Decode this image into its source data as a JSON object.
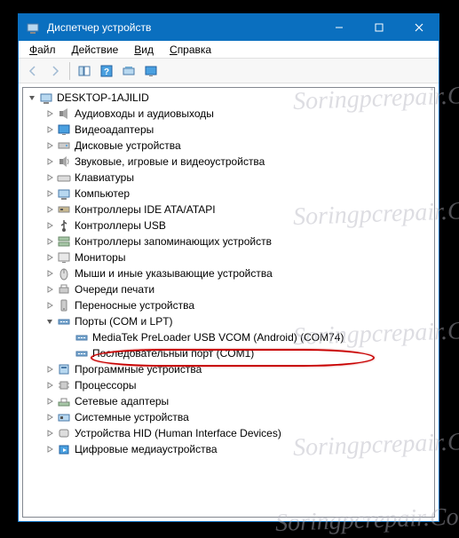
{
  "window": {
    "title": "Диспетчер устройств"
  },
  "menubar": {
    "file": "Файл",
    "action": "Действие",
    "view": "Вид",
    "help": "Справка"
  },
  "toolbar": {
    "back": "back",
    "forward": "forward",
    "showhide": "show-hide-console-tree",
    "help": "help",
    "scan": "scan-hardware",
    "monitor": "monitor"
  },
  "tree": {
    "root": "DESKTOP-1AJILID",
    "items": [
      {
        "label": "Аудиовходы и аудиовыходы",
        "icon": "audio"
      },
      {
        "label": "Видеоадаптеры",
        "icon": "display"
      },
      {
        "label": "Дисковые устройства",
        "icon": "disk"
      },
      {
        "label": "Звуковые, игровые и видеоустройства",
        "icon": "sound"
      },
      {
        "label": "Клавиатуры",
        "icon": "keyboard"
      },
      {
        "label": "Компьютер",
        "icon": "computer"
      },
      {
        "label": "Контроллеры IDE ATA/ATAPI",
        "icon": "ide"
      },
      {
        "label": "Контроллеры USB",
        "icon": "usb"
      },
      {
        "label": "Контроллеры запоминающих устройств",
        "icon": "storage"
      },
      {
        "label": "Мониторы",
        "icon": "monitor"
      },
      {
        "label": "Мыши и иные указывающие устройства",
        "icon": "mouse"
      },
      {
        "label": "Очереди печати",
        "icon": "printer"
      },
      {
        "label": "Переносные устройства",
        "icon": "portable"
      }
    ],
    "ports": {
      "label": "Порты (COM и LPT)",
      "children": [
        {
          "label": "MediaTek PreLoader USB VCOM (Android) (COM74)",
          "highlighted": true
        },
        {
          "label": "Последовательный порт (COM1)",
          "highlighted": false
        }
      ]
    },
    "items2": [
      {
        "label": "Программные устройства",
        "icon": "software"
      },
      {
        "label": "Процессоры",
        "icon": "cpu"
      },
      {
        "label": "Сетевые адаптеры",
        "icon": "network"
      },
      {
        "label": "Системные устройства",
        "icon": "system"
      },
      {
        "label": "Устройства HID (Human Interface Devices)",
        "icon": "hid"
      },
      {
        "label": "Цифровые медиаустройства",
        "icon": "media"
      }
    ]
  },
  "watermark": "Soringpcrepair.Com"
}
